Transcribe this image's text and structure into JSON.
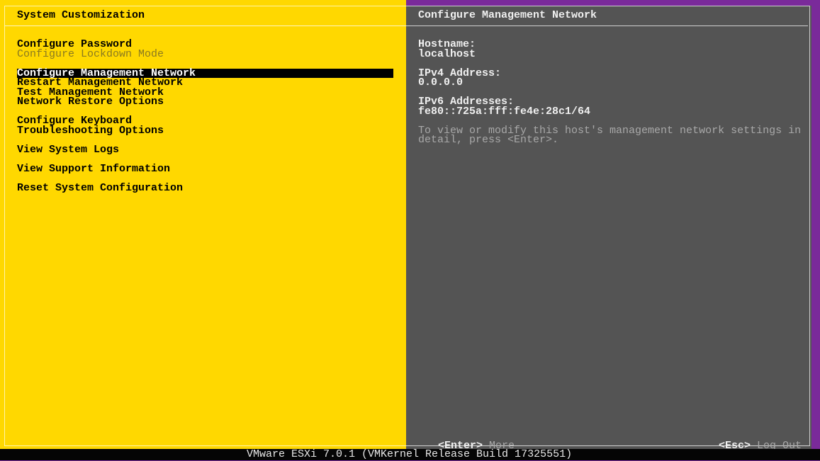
{
  "left_panel": {
    "title": "System Customization",
    "items": [
      {
        "label": "Configure Password",
        "enabled": true
      },
      {
        "label": "Configure Lockdown Mode",
        "enabled": false
      },
      {
        "label": "Configure Management Network",
        "enabled": true,
        "selected": true
      },
      {
        "label": "Restart Management Network",
        "enabled": true
      },
      {
        "label": "Test Management Network",
        "enabled": true
      },
      {
        "label": "Network Restore Options",
        "enabled": true
      },
      {
        "label": "Configure Keyboard",
        "enabled": true
      },
      {
        "label": "Troubleshooting Options",
        "enabled": true
      },
      {
        "label": "View System Logs",
        "enabled": true
      },
      {
        "label": "View Support Information",
        "enabled": true
      },
      {
        "label": "Reset System Configuration",
        "enabled": true
      }
    ]
  },
  "right_panel": {
    "title": "Configure Management Network",
    "hostname_label": "Hostname:",
    "hostname": "localhost",
    "ipv4_label": "IPv4 Address:",
    "ipv4": "0.0.0.0",
    "ipv6_label": "IPv6 Addresses:",
    "ipv6": "fe80::725a:fff:fe4e:28c1/64",
    "help_line1": "To view or modify this host's management network settings in",
    "help_line2": "detail, press <Enter>.",
    "footer_enter_key": "<Enter>",
    "footer_enter_label": "More",
    "footer_esc_key": "<Esc>",
    "footer_esc_label": "Log Out"
  },
  "status_bar": "VMware ESXi 7.0.1 (VMKernel Release Build 17325551)",
  "colors": {
    "left_bg": "#ffd800",
    "right_bg": "#545454",
    "selection": "#000000"
  }
}
